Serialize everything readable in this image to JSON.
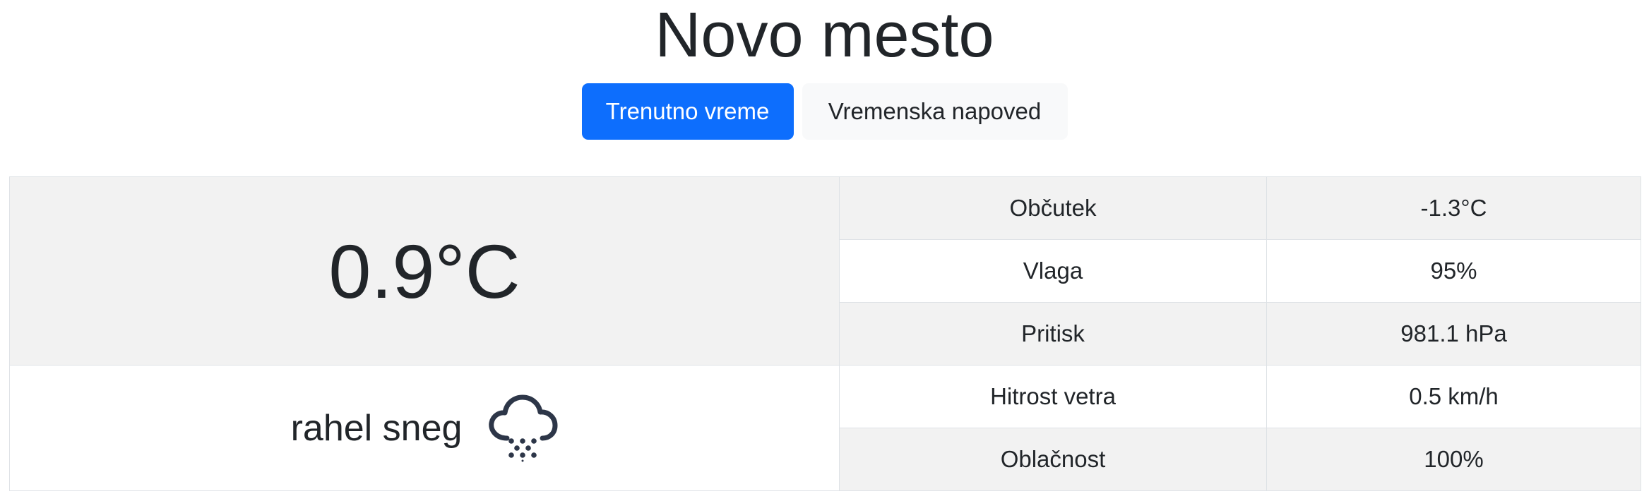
{
  "city": "Novo mesto",
  "tabs": [
    {
      "label": "Trenutno vreme",
      "active": true
    },
    {
      "label": "Vremenska napoved",
      "active": false
    }
  ],
  "current": {
    "temperature": "0.9°C",
    "description": "rahel sneg",
    "icon": "snow-cloud-icon"
  },
  "details": [
    {
      "label": "Občutek",
      "value": "-1.3°C"
    },
    {
      "label": "Vlaga",
      "value": "95%"
    },
    {
      "label": "Pritisk",
      "value": "981.1 hPa"
    },
    {
      "label": "Hitrost vetra",
      "value": "0.5 km/h"
    },
    {
      "label": "Oblačnost",
      "value": "100%"
    }
  ],
  "colors": {
    "accent": "#0d6efd",
    "row_shade": "#f2f2f2",
    "text": "#212529",
    "icon": "#2d3648"
  }
}
